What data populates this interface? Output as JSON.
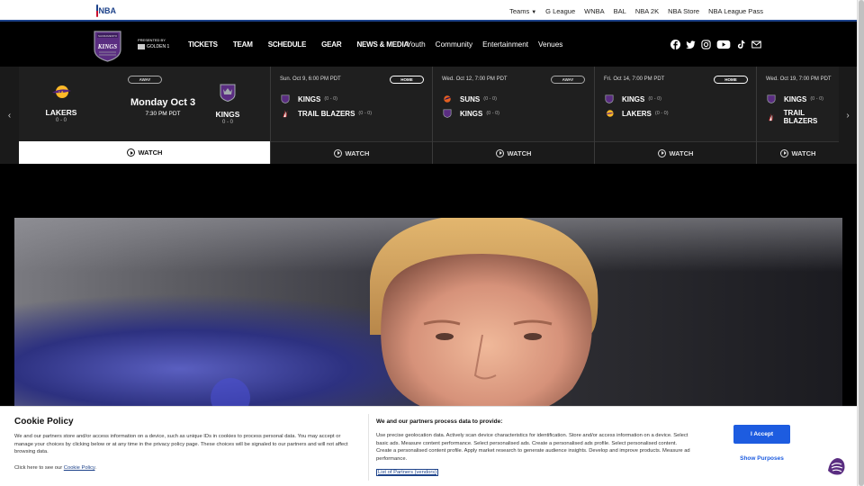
{
  "topbar": {
    "logo_text": "NBA",
    "links": [
      "Teams",
      "G League",
      "WNBA",
      "BAL",
      "NBA 2K",
      "NBA Store",
      "NBA League Pass"
    ]
  },
  "header": {
    "crest_text": "KINGS",
    "crest_subtext": "SACRAMENTO",
    "presented_by": "PRESENTED BY",
    "sponsor": "GOLDEN 1",
    "nav": [
      "TICKETS",
      "TEAM",
      "SCHEDULE",
      "GEAR",
      "NEWS & MEDIA"
    ],
    "subnav": [
      "Youth",
      "Community",
      "Entertainment",
      "Venues"
    ],
    "social_icons": [
      "facebook-icon",
      "twitter-icon",
      "instagram-icon",
      "youtube-icon",
      "tiktok-icon",
      "email-icon"
    ]
  },
  "schedule": {
    "featured": {
      "badge": "AWAY",
      "away_team": "LAKERS",
      "away_record": "0 - 0",
      "home_team": "KINGS",
      "home_record": "0 - 0",
      "date": "Monday Oct 3",
      "time": "7:30 PM PDT",
      "watch": "WATCH"
    },
    "games": [
      {
        "date": "Sun. Oct 9, 6:00 PM PDT",
        "badge": "HOME",
        "team1": "KINGS",
        "rec1": "(0 - 0)",
        "team2": "TRAIL BLAZERS",
        "rec2": "(0 - 0)",
        "watch": "WATCH"
      },
      {
        "date": "Wed. Oct 12, 7:00 PM PDT",
        "badge": "AWAY",
        "team1": "SUNS",
        "rec1": "(0 - 0)",
        "team2": "KINGS",
        "rec2": "(0 - 0)",
        "watch": "WATCH"
      },
      {
        "date": "Fri. Oct 14, 7:00 PM PDT",
        "badge": "HOME",
        "team1": "KINGS",
        "rec1": "(0 - 0)",
        "team2": "LAKERS",
        "rec2": "(0 - 0)",
        "watch": "WATCH"
      },
      {
        "date": "Wed. Oct 19, 7:00 PM PDT",
        "badge": "",
        "team1": "KINGS",
        "rec1": "(0 - 0)",
        "team2": "TRAIL BLAZERS",
        "rec2": "",
        "watch": "WATCH"
      }
    ],
    "prev_arrow": "‹",
    "next_arrow": "›"
  },
  "cookie": {
    "title": "Cookie Policy",
    "text": "We and our partners store and/or access information on a device, such as unique IDs in cookies to process personal data. You may accept or manage your choices by clicking below or at any time in the privacy policy page. These choices will be signaled to our partners and will not affect browsing data.",
    "policy_prefix": "Click here to see our",
    "policy_link": "Cookie Policy",
    "policy_suffix": ".",
    "subtitle": "We and our partners process data to provide:",
    "purposes_text": "Use precise geolocation data. Actively scan device characteristics for identification. Store and/or access information on a device. Select basic ads. Measure content performance. Select personalised ads. Create a personalised ads profile. Select personalised content. Create a personalised content profile. Apply market research to generate audience insights. Develop and improve products. Measure ad performance.",
    "vendors_link": "List of Partners (vendors)",
    "accept": "I Accept",
    "show_purposes": "Show Purposes"
  },
  "colors": {
    "nba_blue": "#1d428a",
    "kings_purple": "#5a2d81",
    "accept_blue": "#1d5ce0"
  }
}
